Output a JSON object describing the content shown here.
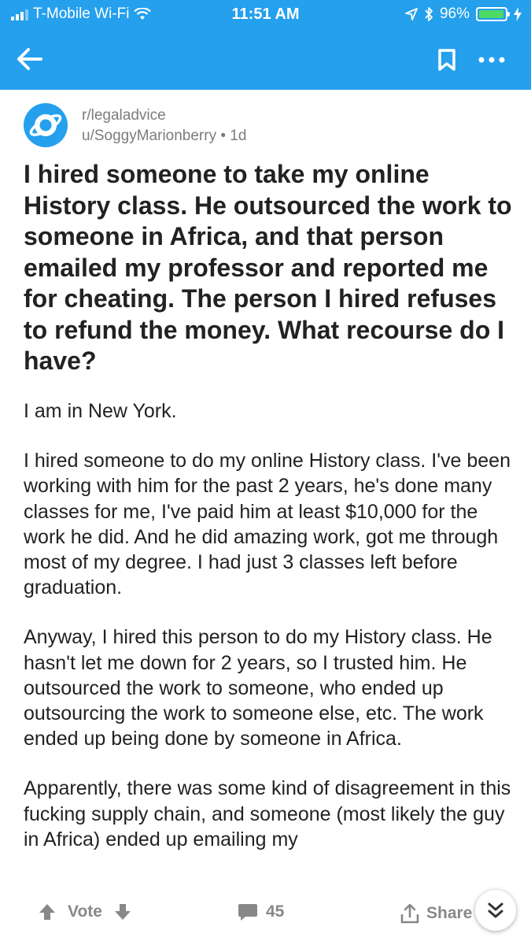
{
  "status_bar": {
    "carrier": "T-Mobile Wi-Fi",
    "time": "11:51 AM",
    "battery_percent": "96%",
    "battery_level": 0.96,
    "icons": [
      "signal-icon",
      "wifi-icon",
      "location-icon",
      "bluetooth-icon",
      "battery-icon",
      "charging-icon"
    ]
  },
  "app_bar": {
    "icons": [
      "back-arrow-icon",
      "bookmark-icon",
      "more-icon"
    ],
    "color": "#24a0ed"
  },
  "post": {
    "subreddit": "r/legaladvice",
    "author_line": "u/SoggyMarionberry • 1d",
    "title": "I hired someone to take my online History class. He outsourced the work to someone in Africa, and that person emailed my professor and reported me for cheating. The person I hired refuses to refund the money. What recourse do I have?",
    "paragraphs": [
      "I am in New York.",
      "I hired someone to do my online History class. I've been working with him for the past 2 years, he's done many classes for me, I've paid him at least $10,000 for the work he did. And he did amazing work, got me through most of my degree. I had just 3 classes left before graduation.",
      "Anyway, I hired this person to do my History class. He hasn't let me down for 2 years, so I trusted him. He outsourced the work to someone, who ended up outsourcing the work to someone else, etc. The work ended up being done by someone in Africa.",
      "Apparently, there was some kind of disagreement in this fucking supply chain, and someone (most likely the guy in Africa) ended up emailing my"
    ]
  },
  "action_bar": {
    "vote_label": "Vote",
    "comment_count": "45",
    "share_label": "Share",
    "icons": [
      "upvote-icon",
      "downvote-icon",
      "comment-icon",
      "share-icon",
      "scroll-down-icon"
    ]
  }
}
